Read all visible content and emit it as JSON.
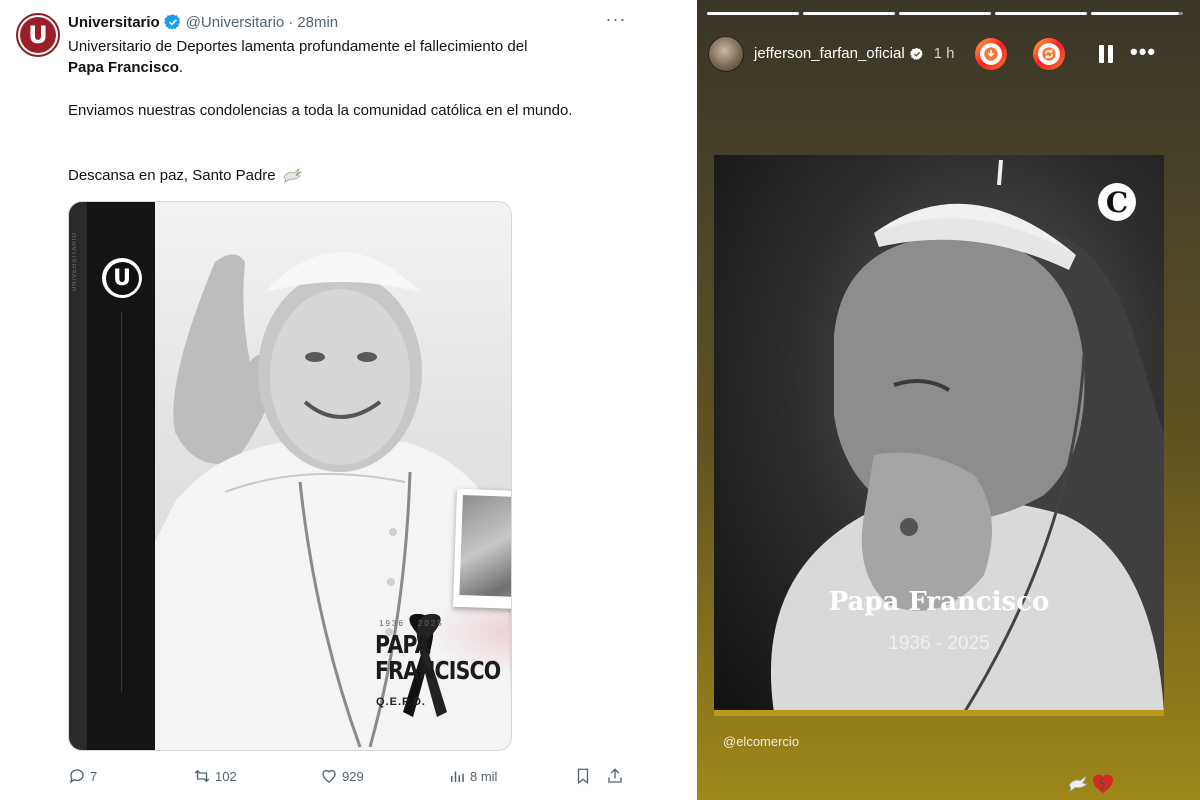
{
  "tweet": {
    "account_name": "Universitario",
    "handle": "@Universitario",
    "separator": "·",
    "time": "28min",
    "more_label": "···",
    "avatar_letter": "U",
    "text_line1": "Universitario de Deportes lamenta profundamente el fallecimiento del",
    "text_bold": "Papa Francisco",
    "text_period": ".",
    "text_para2": "Enviamos nuestras condolencias a toda la comunidad católica en el mundo.",
    "text_para3": "Descansa en paz, Santo Padre",
    "media": {
      "logo_letter": "U",
      "side_text": "UNIVERSITARIO",
      "years": "1936 - 2025",
      "title_line1": "PAPA",
      "title_line2": "FRANCISCO",
      "qepd": "Q.E.P.D."
    },
    "actions": {
      "replies": "7",
      "reposts": "102",
      "likes": "929",
      "views": "8 mil"
    },
    "colors": {
      "verified": "#1d9bf0",
      "text_secondary": "#536471",
      "brand_red": "#9a1f26"
    }
  },
  "story": {
    "username": "jefferson_farfan_oficial",
    "time": "1 h",
    "more_label": "•••",
    "progress_segments": 5,
    "card": {
      "logo_letter": "C",
      "title": "Papa Francisco",
      "years": "1936 - 2025"
    },
    "mention": "@elcomercio",
    "colors": {
      "gold": "#b99a1f",
      "broken_heart": "#d62828"
    }
  }
}
